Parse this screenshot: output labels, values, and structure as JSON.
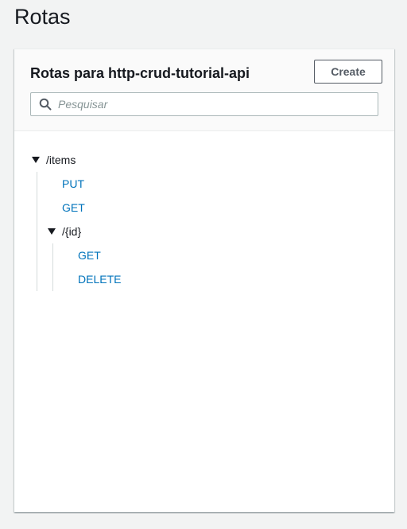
{
  "page": {
    "title": "Rotas"
  },
  "panel": {
    "heading": "Rotas para http-crud-tutorial-api",
    "create_label": "Create",
    "search": {
      "placeholder": "Pesquisar",
      "value": ""
    }
  },
  "routes": {
    "items": {
      "path": "/items",
      "methods": [
        "PUT",
        "GET"
      ],
      "id": {
        "path": "/{id}",
        "methods": [
          "GET",
          "DELETE"
        ]
      }
    }
  },
  "colors": {
    "background": "#f2f3f3",
    "panel": "#ffffff",
    "panel_header": "#fafafa",
    "link": "#0073bb",
    "text": "#16191f",
    "button_border": "#545b64"
  }
}
